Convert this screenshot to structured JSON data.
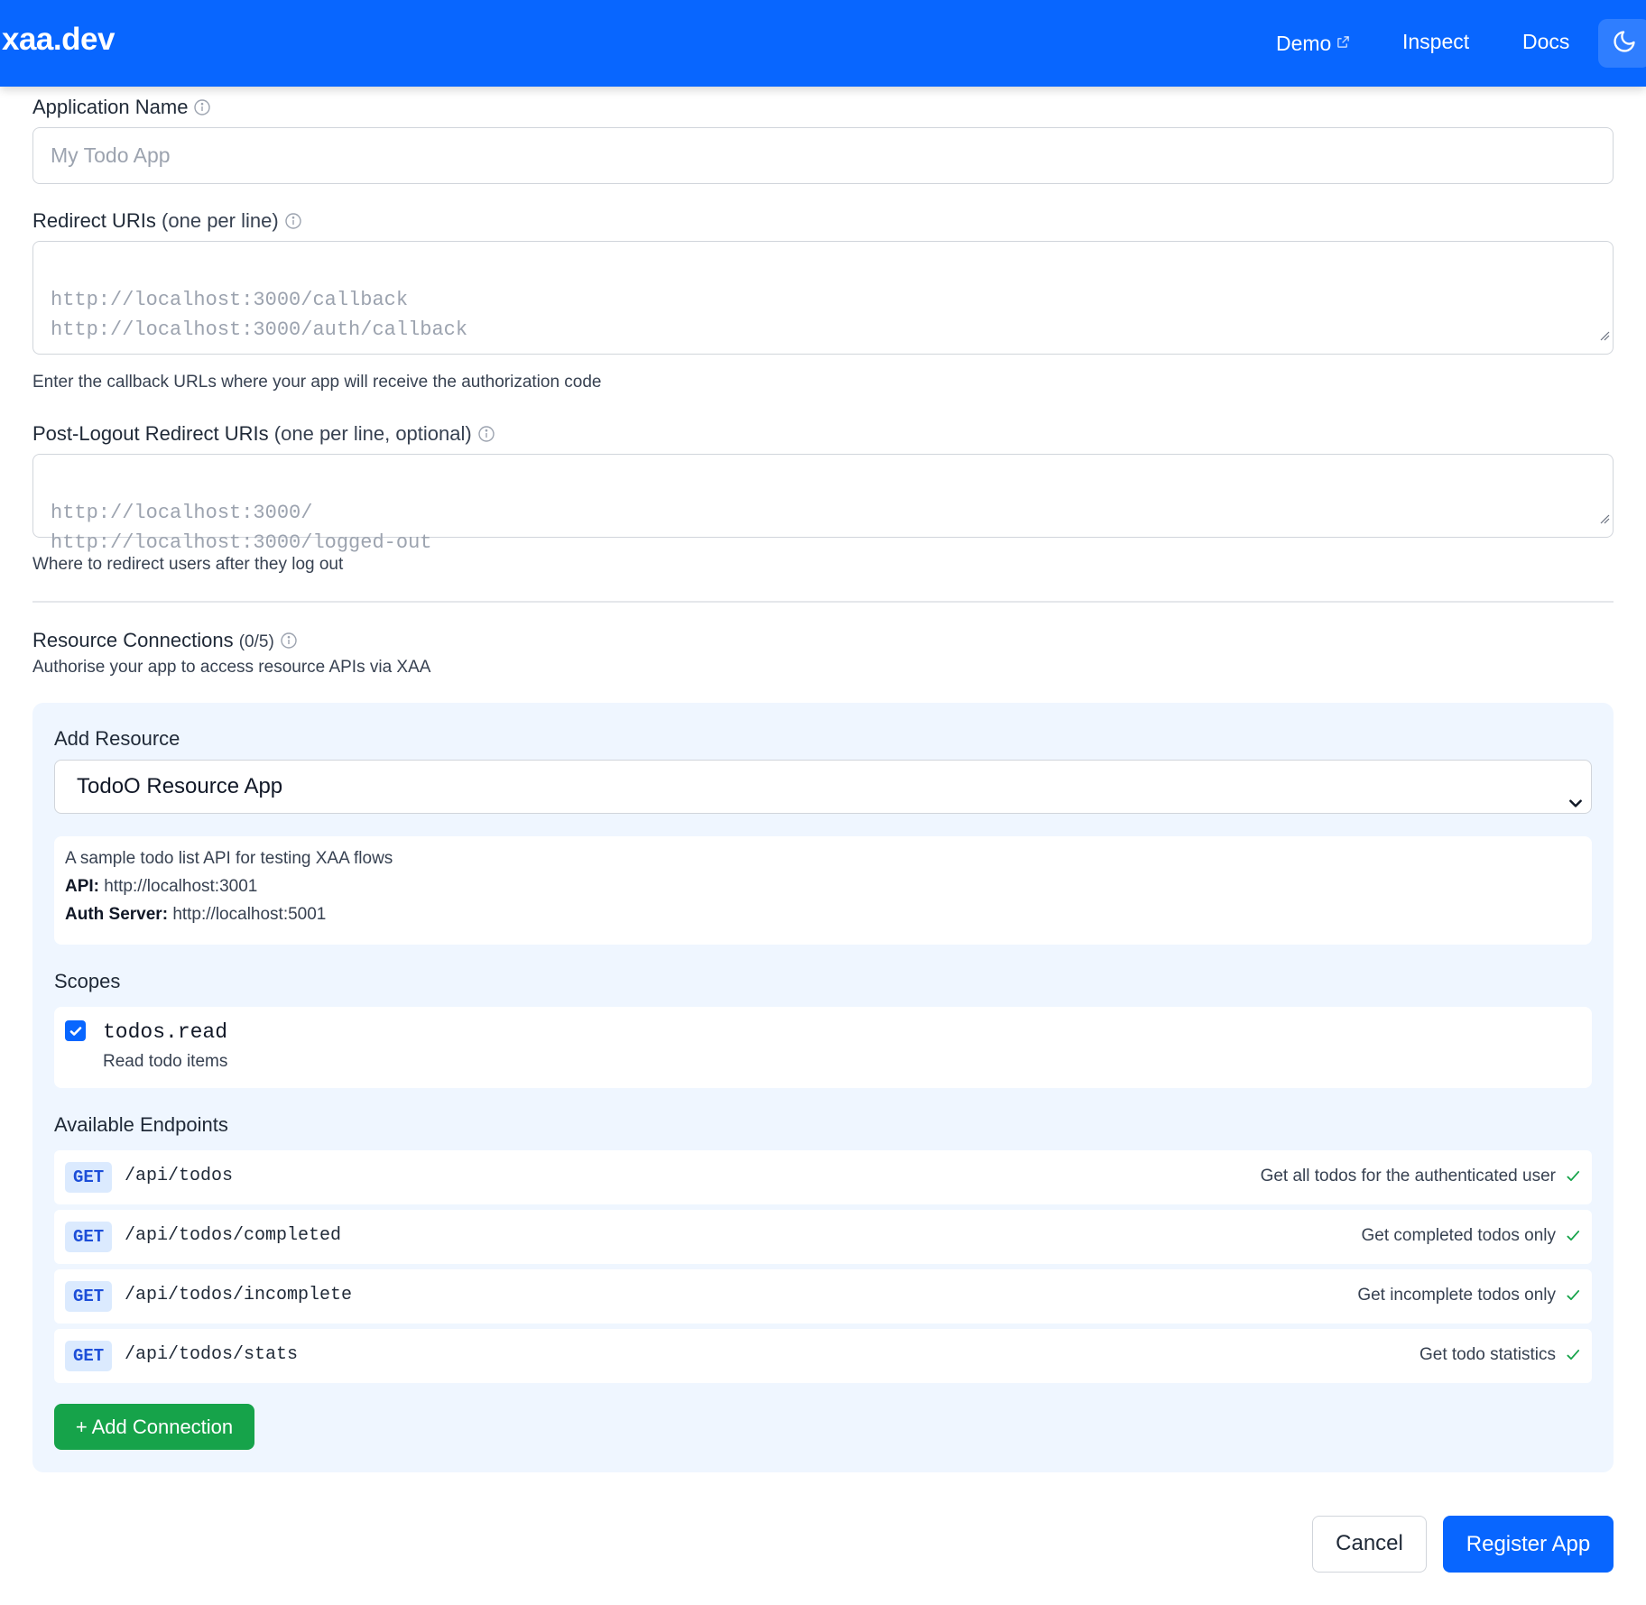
{
  "header": {
    "brand": "xaa.dev",
    "nav": {
      "demo": "Demo",
      "inspect": "Inspect",
      "docs": "Docs"
    },
    "icons": {
      "demo_external": "external-link-icon",
      "theme": "moon-icon"
    },
    "color": "#0866ff"
  },
  "form": {
    "app_name": {
      "label": "Application Name",
      "placeholder": "My Todo App"
    },
    "redirect_uris": {
      "label": "Redirect URIs",
      "label_suffix": "(one per line)",
      "placeholder_lines": [
        "http://localhost:3000/callback",
        "http://localhost:3000/auth/callback"
      ],
      "hint": "Enter the callback URLs where your app will receive the authorization code"
    },
    "post_logout_uris": {
      "label": "Post-Logout Redirect URIs",
      "label_suffix": "(one per line, optional)",
      "placeholder_lines": [
        "http://localhost:3000/",
        "http://localhost:3000/logged-out"
      ],
      "hint": "Where to redirect users after they log out"
    }
  },
  "resources": {
    "title": "Resource Connections",
    "count": "(0/5)",
    "subtitle": "Authorise your app to access resource APIs via XAA",
    "add_resource_label": "Add Resource",
    "selected_resource": "TodoO Resource App",
    "info": {
      "description": "A sample todo list API for testing XAA flows",
      "api_label": "API:",
      "api_value": "http://localhost:3001",
      "auth_label": "Auth Server:",
      "auth_value": "http://localhost:5001"
    },
    "scopes_label": "Scopes",
    "scopes": [
      {
        "name": "todos.read",
        "description": "Read todo items",
        "checked": true
      }
    ],
    "endpoints_label": "Available Endpoints",
    "endpoints": [
      {
        "method": "GET",
        "path": "/api/todos",
        "description": "Get all todos for the authenticated user"
      },
      {
        "method": "GET",
        "path": "/api/todos/completed",
        "description": "Get completed todos only"
      },
      {
        "method": "GET",
        "path": "/api/todos/incomplete",
        "description": "Get incomplete todos only"
      },
      {
        "method": "GET",
        "path": "/api/todos/stats",
        "description": "Get todo statistics"
      }
    ],
    "add_connection_label": "+ Add Connection"
  },
  "actions": {
    "cancel": "Cancel",
    "register": "Register App"
  },
  "colors": {
    "primary": "#0866ff",
    "success": "#16a34a",
    "panel_bg": "#eff6ff",
    "method_badge_bg": "#dbeafe",
    "method_badge_text": "#1d4ed8"
  }
}
